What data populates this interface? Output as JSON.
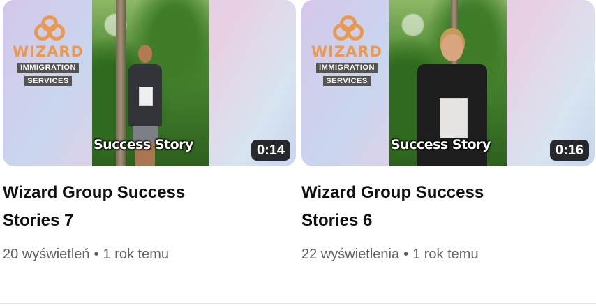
{
  "videos": [
    {
      "logo_word": "WIZARD",
      "logo_line1": "IMMIGRATION",
      "logo_line2": "SERVICES",
      "overlay_text": "Success Story",
      "duration": "0:14",
      "title": "Wizard Group Success Stories 7",
      "views": "20 wyświetleń",
      "separator": "•",
      "age": "1 rok temu"
    },
    {
      "logo_word": "WIZARD",
      "logo_line1": "IMMIGRATION",
      "logo_line2": "SERVICES",
      "overlay_text": "Success Story",
      "duration": "0:16",
      "title": "Wizard Group Success Stories 6",
      "views": "22 wyświetlenia",
      "separator": "•",
      "age": "1 rok temu"
    }
  ],
  "colors": {
    "brand_orange": "#e89a50",
    "title_text": "#0f0f0f",
    "meta_text": "#606060",
    "duration_badge_bg": "#000000"
  }
}
